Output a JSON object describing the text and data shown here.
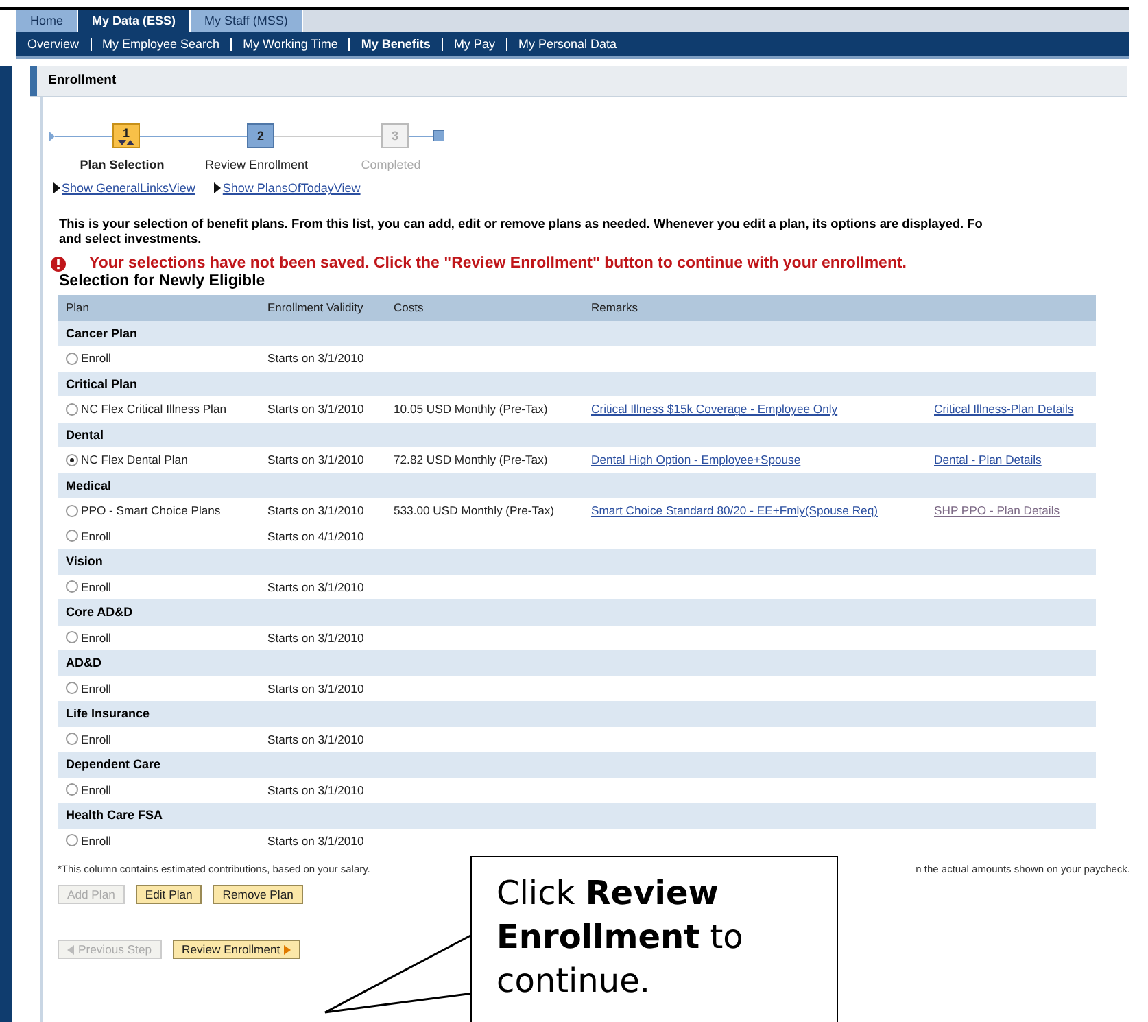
{
  "top_tabs": [
    {
      "label": "Home",
      "selected": false
    },
    {
      "label": "My Data (ESS)",
      "selected": true
    },
    {
      "label": "My Staff (MSS)",
      "selected": false
    }
  ],
  "sub_nav": [
    {
      "label": "Overview",
      "selected": false
    },
    {
      "label": "My Employee Search",
      "selected": false
    },
    {
      "label": "My Working Time",
      "selected": false
    },
    {
      "label": "My Benefits",
      "selected": true
    },
    {
      "label": "My Pay",
      "selected": false
    },
    {
      "label": "My Personal Data",
      "selected": false
    }
  ],
  "panel": {
    "title": "Enrollment"
  },
  "steps": [
    {
      "number": "1",
      "label": "Plan Selection",
      "selected": true,
      "disabled": false
    },
    {
      "number": "2",
      "label": "Review Enrollment",
      "selected": false,
      "disabled": false
    },
    {
      "number": "3",
      "label": "Completed",
      "selected": false,
      "disabled": true
    }
  ],
  "view_links": [
    "Show GeneralLinksView",
    "Show PlansOfTodayView"
  ],
  "intro_lines": [
    "This is your selection of benefit plans. From this list, you can add, edit or remove plans as needed. Whenever you edit a plan, its options are displayed. Fo",
    "and select investments."
  ],
  "error_message": "Your selections have not been saved. Click the \"Review Enrollment\" button to continue with your enrollment.",
  "section_title": "Selection for Newly Eligible",
  "table": {
    "columns": [
      "Plan",
      "Enrollment Validity",
      "Costs",
      "Remarks"
    ],
    "groups": [
      {
        "name": "Cancer Plan",
        "rows": [
          {
            "plan": "Enroll",
            "selected": false,
            "validity": "Starts on 3/1/2010"
          }
        ]
      },
      {
        "name": "Critical Plan",
        "rows": [
          {
            "plan": "NC Flex Critical Illness Plan",
            "selected": false,
            "validity": "Starts on 3/1/2010",
            "costs": "10.05 USD Monthly (Pre-Tax)",
            "remark": "Critical Illness $15k Coverage - Employee Only",
            "details": "Critical Illness-Plan Details",
            "visited": false
          }
        ]
      },
      {
        "name": "Dental",
        "rows": [
          {
            "plan": "NC Flex Dental Plan",
            "selected": true,
            "validity": "Starts on 3/1/2010",
            "costs": "72.82 USD Monthly (Pre-Tax)",
            "remark": "Dental High Option - Employee+Spouse",
            "details": "Dental - Plan Details",
            "visited": false
          }
        ]
      },
      {
        "name": "Medical",
        "rows": [
          {
            "plan": "PPO - Smart Choice Plans",
            "selected": false,
            "validity": "Starts on 3/1/2010",
            "costs": "533.00 USD Monthly (Pre-Tax)",
            "remark": "Smart Choice Standard  80/20 - EE+Fmly(Spouse Req)",
            "details": "SHP PPO - Plan Details",
            "visited": true
          },
          {
            "plan": "Enroll",
            "selected": false,
            "validity": "Starts on 4/1/2010"
          }
        ]
      },
      {
        "name": "Vision",
        "rows": [
          {
            "plan": "Enroll",
            "selected": false,
            "validity": "Starts on 3/1/2010"
          }
        ]
      },
      {
        "name": "Core AD&D",
        "rows": [
          {
            "plan": "Enroll",
            "selected": false,
            "validity": "Starts on 3/1/2010"
          }
        ]
      },
      {
        "name": "AD&D",
        "rows": [
          {
            "plan": "Enroll",
            "selected": false,
            "validity": "Starts on 3/1/2010"
          }
        ]
      },
      {
        "name": "Life Insurance",
        "rows": [
          {
            "plan": "Enroll",
            "selected": false,
            "validity": "Starts on 3/1/2010"
          }
        ]
      },
      {
        "name": "Dependent Care",
        "rows": [
          {
            "plan": "Enroll",
            "selected": false,
            "validity": "Starts on 3/1/2010"
          }
        ]
      },
      {
        "name": "Health Care FSA",
        "rows": [
          {
            "plan": "Enroll",
            "selected": false,
            "validity": "Starts on 3/1/2010"
          }
        ]
      }
    ]
  },
  "footnote": [
    "*This column contains estimated contributions, based on your salary.",
    "n the actual amounts shown on your paycheck."
  ],
  "action_buttons": [
    {
      "label": "Add Plan",
      "disabled": true
    },
    {
      "label": "Edit Plan",
      "disabled": false
    },
    {
      "label": "Remove Plan",
      "disabled": false
    }
  ],
  "step_buttons": [
    {
      "label": "Previous Step",
      "disabled": true,
      "kind": "back"
    },
    {
      "label": "Review Enrollment",
      "disabled": false,
      "kind": "forward"
    }
  ],
  "callout": {
    "text": "Click **Review Enrollment** to continue."
  }
}
